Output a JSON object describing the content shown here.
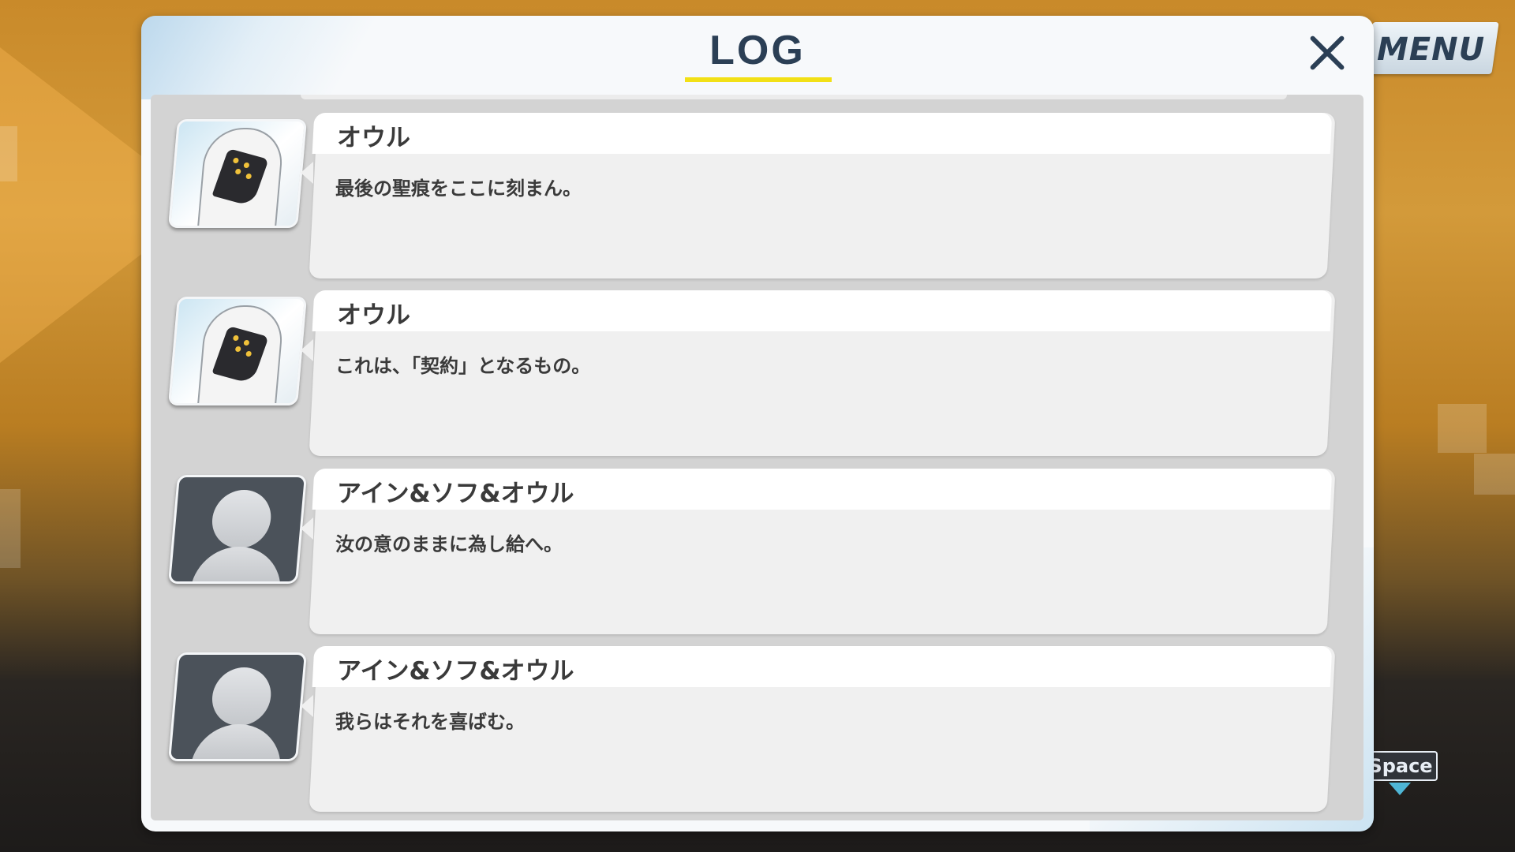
{
  "menu": {
    "label": "MENU"
  },
  "hint": {
    "space_label": "Space"
  },
  "log": {
    "title": "LOG",
    "entries": [
      {
        "speaker": "オウル",
        "text": "最後の聖痕をここに刻まん。",
        "avatar": "owl-portrait"
      },
      {
        "speaker": "オウル",
        "text": "これは、「契約」となるもの。",
        "avatar": "owl-portrait"
      },
      {
        "speaker": "アイン&ソフ&オウル",
        "text": "汝の意のままに為し給へ。",
        "avatar": "silhouette-avatar-icon"
      },
      {
        "speaker": "アイン&ソフ&オウル",
        "text": "我らはそれを喜ばむ。",
        "avatar": "silhouette-avatar-icon"
      }
    ]
  },
  "colors": {
    "title_text": "#2b3f55",
    "underline": "#f2e016",
    "space_arrow": "#4fb6d6"
  },
  "icons": {
    "close": "close-icon",
    "space_arrow": "down-arrow-icon"
  }
}
